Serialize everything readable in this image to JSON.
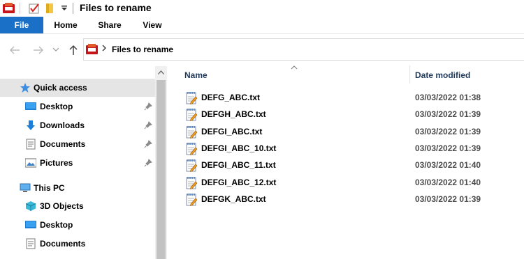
{
  "window": {
    "title": "Files to rename"
  },
  "ribbon": {
    "tabs": {
      "file": "File",
      "home": "Home",
      "share": "Share",
      "view": "View"
    }
  },
  "address": {
    "path": "Files to rename"
  },
  "nav_pane": {
    "quick_access": "Quick access",
    "quick_items": [
      "Desktop",
      "Downloads",
      "Documents",
      "Pictures"
    ],
    "this_pc": "This PC",
    "pc_items": [
      "3D Objects",
      "Desktop",
      "Documents"
    ]
  },
  "columns": {
    "name": "Name",
    "date": "Date modified"
  },
  "files": [
    {
      "name": "DEFG_ABC.txt",
      "date": "03/03/2022 01:38"
    },
    {
      "name": "DEFGH_ABC.txt",
      "date": "03/03/2022 01:39"
    },
    {
      "name": "DEFGI_ABC.txt",
      "date": "03/03/2022 01:39"
    },
    {
      "name": "DEFGI_ABC_10.txt",
      "date": "03/03/2022 01:39"
    },
    {
      "name": "DEFGI_ABC_11.txt",
      "date": "03/03/2022 01:40"
    },
    {
      "name": "DEFGI_ABC_12.txt",
      "date": "03/03/2022 01:40"
    },
    {
      "name": "DEFGK_ABC.txt",
      "date": "03/03/2022 01:39"
    }
  ],
  "colors": {
    "accent": "#1a6fc6",
    "selected_bg": "#e5e5e5",
    "header_text": "#1e395b"
  }
}
